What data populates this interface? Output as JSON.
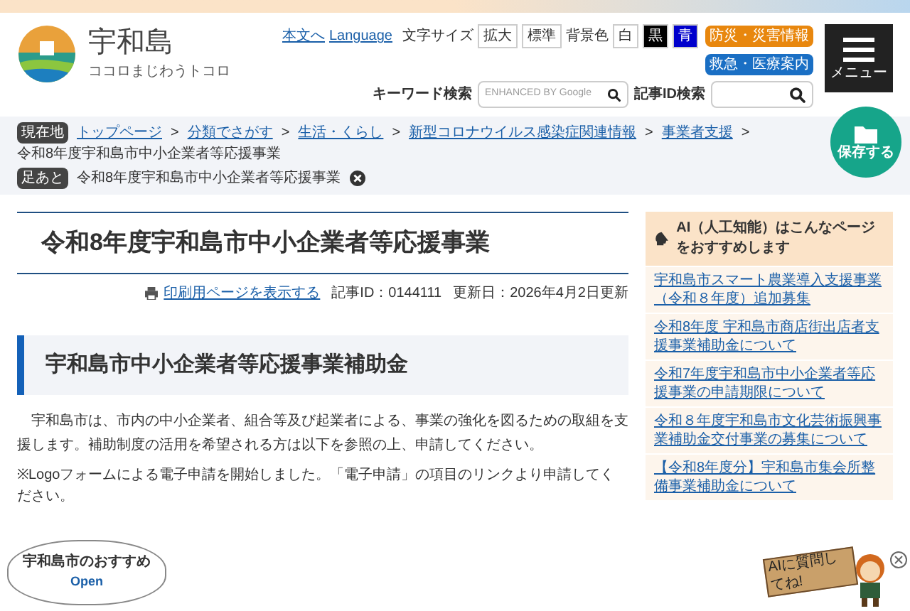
{
  "header": {
    "site_name": "宇和島",
    "tagline": "ココロまじわうトコロ",
    "skip_link": "本文へ",
    "language_link": "Language",
    "font_size_label": "文字サイズ",
    "font_size_buttons": [
      {
        "label": "拡大",
        "selected": false
      },
      {
        "label": "標準",
        "selected": false
      }
    ],
    "bg_color_label": "背景色",
    "bg_color_buttons": [
      {
        "label": "白",
        "color": "#ffffff"
      },
      {
        "label": "黒",
        "color": "#000000"
      },
      {
        "label": "青",
        "color": "#0000cc"
      }
    ],
    "quick_buttons": [
      {
        "label": "防災・災害情報",
        "color": "#e8870e"
      },
      {
        "label": "救急・医療案内",
        "color": "#1a6fc4"
      }
    ],
    "keyword_search": {
      "label": "キーワード検索",
      "placeholder": "ENHANCED BY Google"
    },
    "id_search": {
      "label": "記事ID検索"
    },
    "menu_button": "メニュー"
  },
  "breadcrumb": {
    "label": "現在地",
    "items": [
      {
        "text": "トップページ",
        "link": true
      },
      {
        "text": "分類でさがす",
        "link": true
      },
      {
        "text": "生活・くらし",
        "link": true
      },
      {
        "text": "新型コロナウイルス感染症関連情報",
        "link": true
      },
      {
        "text": "事業者支援",
        "link": true
      },
      {
        "text": "令和8年度宇和島市中小企業者等応援事業",
        "link": false
      }
    ],
    "separator": ">"
  },
  "history": {
    "label": "足あと",
    "items": [
      "令和8年度宇和島市中小企業者等応援事業"
    ]
  },
  "save_button": "保存する",
  "article": {
    "title": "令和8年度宇和島市中小企業者等応援事業",
    "print_link": "印刷用ページを表示する",
    "article_id": "記事ID：0144111",
    "updated": "更新日：2026年4月2日更新",
    "section_heading": "宇和島市中小企業者等応援事業補助金",
    "paragraph": "宇和島市は、市内の中小企業者、組合等及び起業者による、事業の強化を図るための取組を支援します。補助制度の活用を希望される方は以下を参照の上、申請してください。",
    "note": "※Logoフォームによる電子申請を開始しました。「電子申請」の項目のリンクより申請してください。"
  },
  "recommend_bubble": {
    "title": "宇和島市のおすすめ",
    "action": "Open"
  },
  "ai_panel": {
    "heading": "AI（人工知能）はこんなページをおすすめします",
    "items": [
      "宇和島市スマート農業導入支援事業（令和８年度）追加募集",
      "令和8年度 宇和島市商店街出店者支援事業補助金について",
      "令和7年度宇和島市中小企業者等応援事業の申請期限について",
      "令和８年度宇和島市文化芸術振興事業補助金交付事業の募集について",
      "【令和8年度分】宇和島市集会所整備事業補助金について"
    ]
  },
  "mascot": {
    "sign": "AIに質問してね!"
  }
}
